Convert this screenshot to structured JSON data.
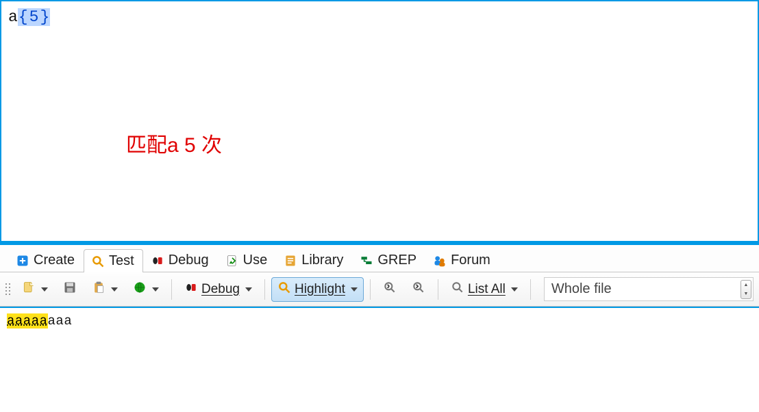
{
  "regex": {
    "literal": "a",
    "open_brace": "{",
    "quantifier": "5",
    "close_brace": "}"
  },
  "annotation": "匹配a 5 次",
  "tabs": {
    "create": "Create",
    "test": "Test",
    "debug": "Debug",
    "use": "Use",
    "library": "Library",
    "grep": "GREP",
    "forum": "Forum",
    "active": "test"
  },
  "toolbar": {
    "debug_label": "Debug",
    "highlight_label": "Highlight",
    "list_all_label": "List All",
    "whole_file_label": "Whole file"
  },
  "result": {
    "highlighted": "aaaaa",
    "rest": "aaa"
  }
}
